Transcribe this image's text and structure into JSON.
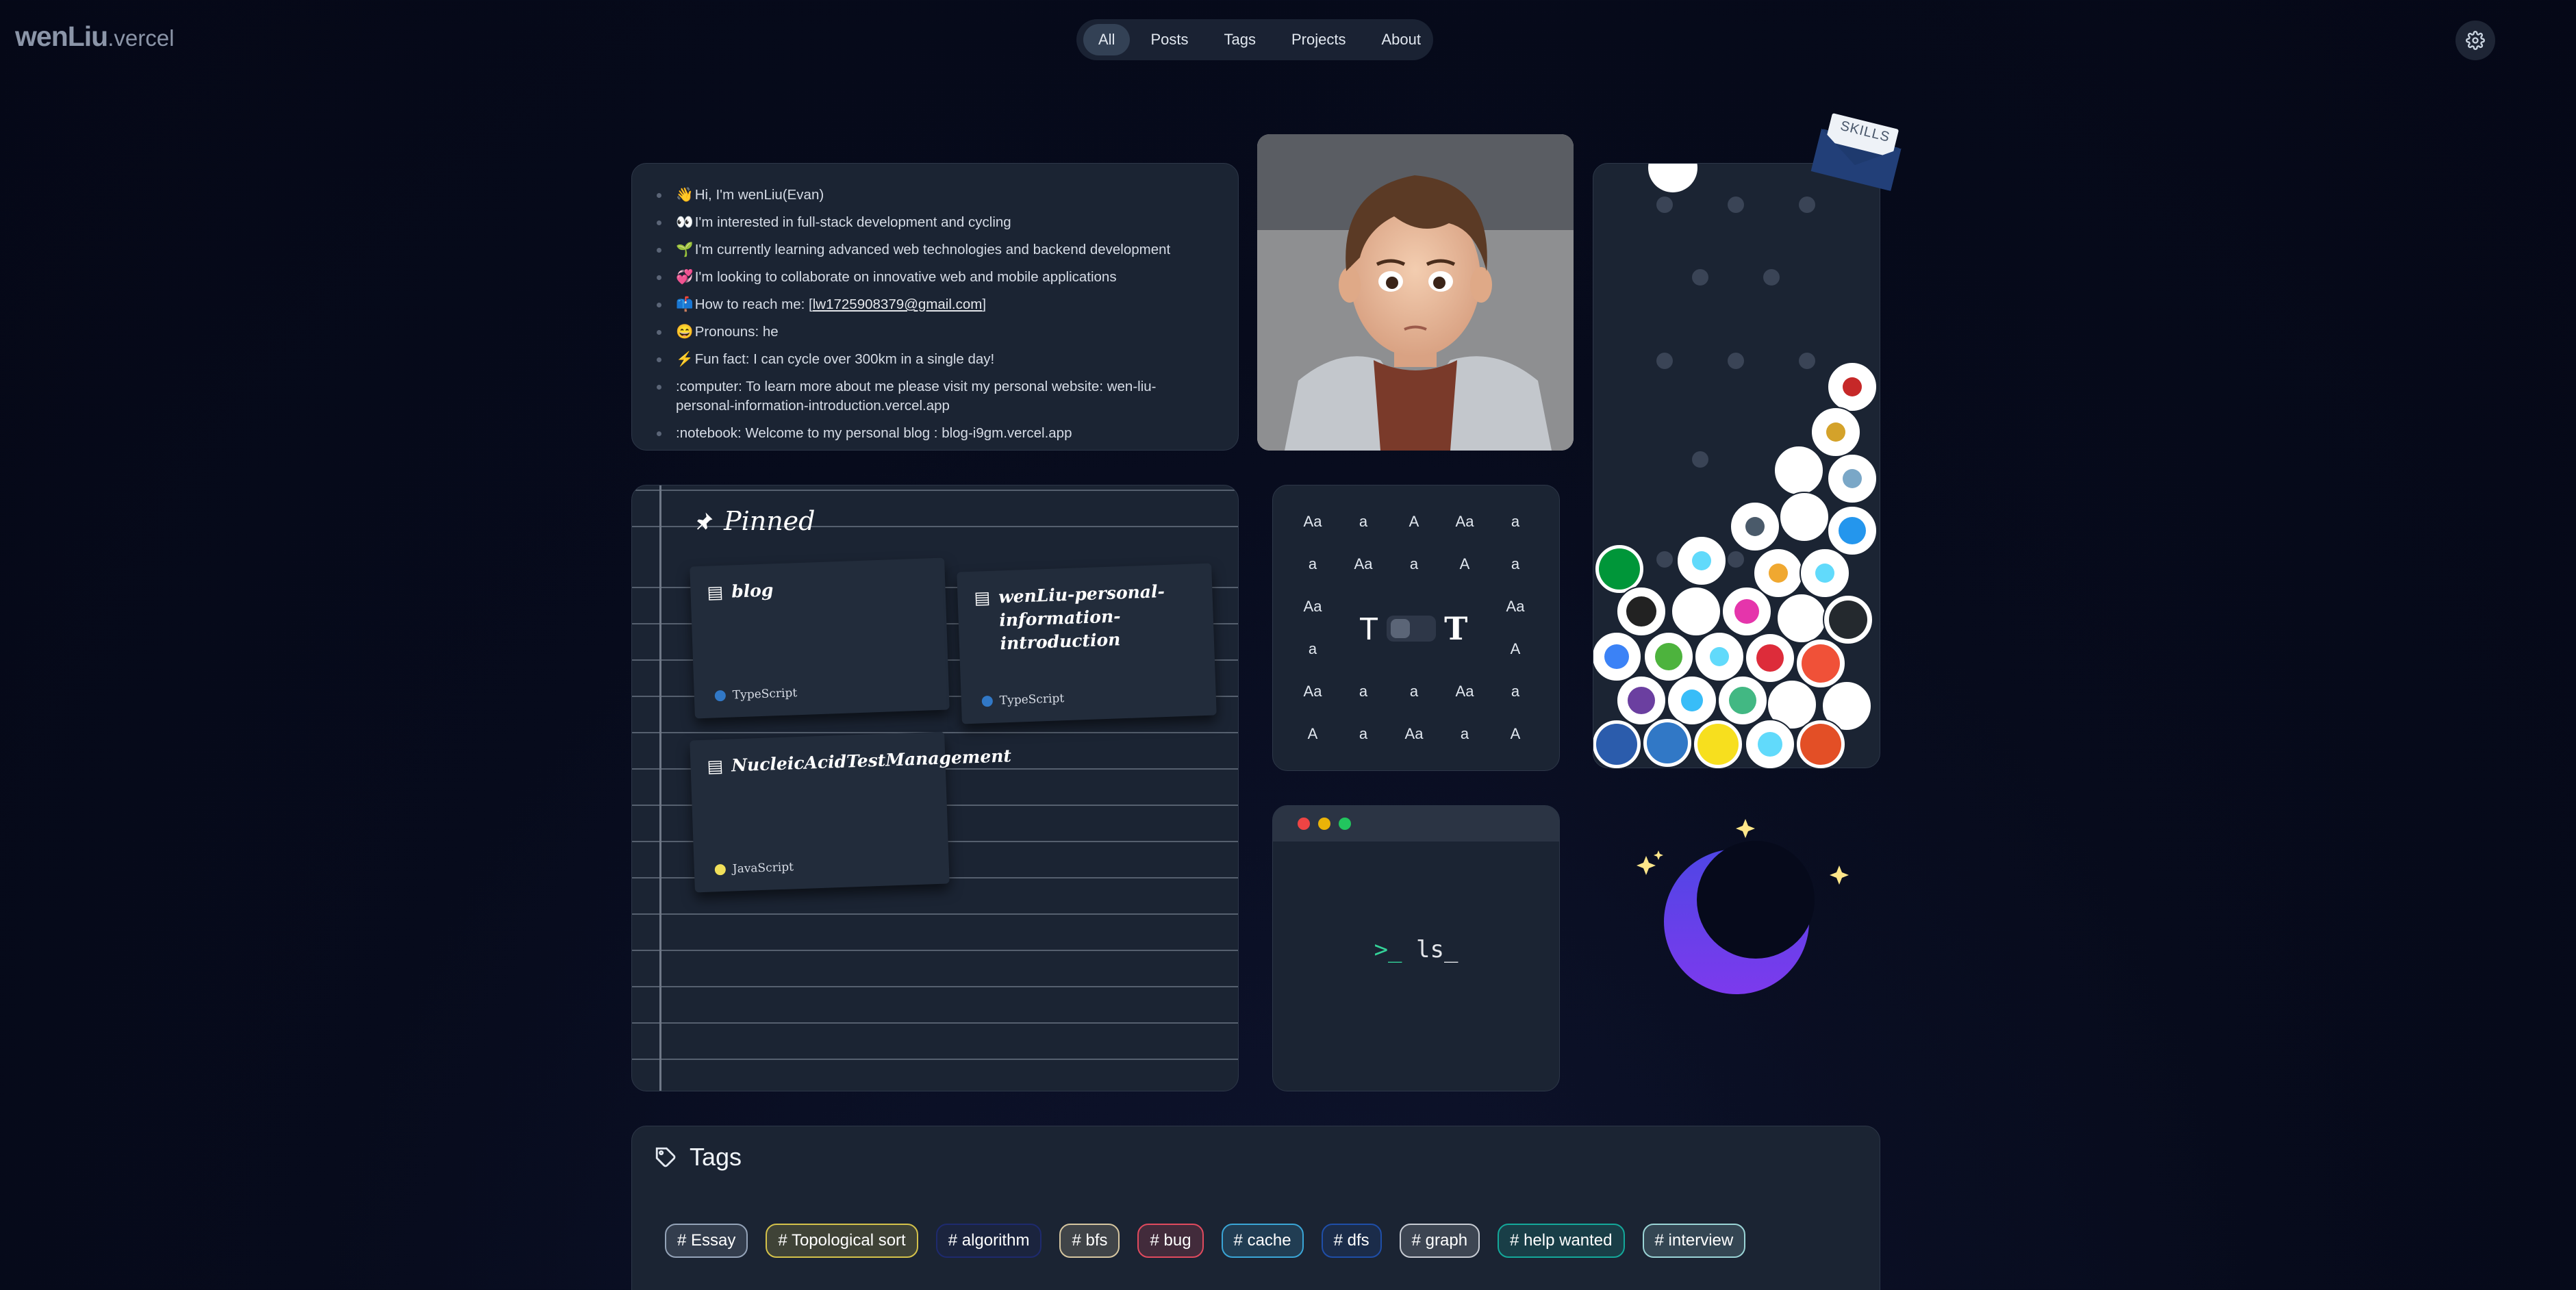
{
  "header": {
    "logo_main": "wenLiu",
    "logo_suffix": ".vercel",
    "nav": [
      "All",
      "Posts",
      "Tags",
      "Projects",
      "About"
    ],
    "active_nav": "All"
  },
  "intro": {
    "items": [
      {
        "emoji": "👋",
        "text": "Hi, I'm wenLiu(Evan)"
      },
      {
        "emoji": "👀",
        "text": "I'm interested in full-stack development and cycling"
      },
      {
        "emoji": "🌱",
        "text": "I'm currently learning advanced web technologies and backend development"
      },
      {
        "emoji": "💞",
        "text": "I'm looking to collaborate on innovative web and mobile applications"
      },
      {
        "emoji": "📫",
        "text": "How to reach me: [",
        "link": "lw1725908379@gmail.com",
        "after": "]"
      },
      {
        "emoji": "😄",
        "text": "Pronouns: he"
      },
      {
        "emoji": "⚡",
        "text": "Fun fact: I can cycle over 300km in a single day!"
      },
      {
        "emoji": "",
        "text": ":computer: To learn more about me please visit my personal website: wen-liu-personal-information-introduction.vercel.app"
      },
      {
        "emoji": "",
        "text": ":notebook: Welcome to my personal blog : blog-i9gm.vercel.app"
      }
    ]
  },
  "skills": {
    "label": "SKILLS"
  },
  "pinned": {
    "title": "Pinned",
    "repos": [
      {
        "name": "blog",
        "lang": "TypeScript",
        "color": "#3178c6"
      },
      {
        "name": "wenLiu-personal-information-introduction",
        "lang": "TypeScript",
        "color": "#3178c6"
      },
      {
        "name": "NucleicAcidTestManagement",
        "lang": "JavaScript",
        "color": "#f1e05a"
      }
    ]
  },
  "fonts": {
    "glyphs": [
      [
        "Aa",
        "a",
        "A",
        "Aa",
        "a"
      ],
      [
        "a",
        "Aa",
        "a",
        "A",
        "a"
      ],
      [
        "Aa",
        "",
        "",
        "",
        "Aa"
      ],
      [
        "a",
        "",
        "",
        "",
        "A"
      ],
      [
        "Aa",
        "a",
        "a",
        "Aa",
        "a"
      ],
      [
        "A",
        "a",
        "Aa",
        "a",
        "A"
      ]
    ],
    "toggle_left": "T",
    "toggle_right": "T"
  },
  "terminal": {
    "prompt": ">_",
    "command": "ls_"
  },
  "tags": {
    "title": "Tags",
    "items": [
      {
        "label": "# Essay",
        "color": "#94a3b8"
      },
      {
        "label": "# Topological sort",
        "color": "#d4c24a"
      },
      {
        "label": "# algorithm",
        "color": "#1e2a6e"
      },
      {
        "label": "# bfs",
        "color": "#d6c6a0"
      },
      {
        "label": "# bug",
        "color": "#e04a5e"
      },
      {
        "label": "# cache",
        "color": "#3aa5d6"
      },
      {
        "label": "# dfs",
        "color": "#1f4ea8"
      },
      {
        "label": "# graph",
        "color": "#c7cbd3"
      },
      {
        "label": "# help wanted",
        "color": "#14a89a"
      },
      {
        "label": "# interview",
        "color": "#9ad4d6"
      }
    ]
  }
}
